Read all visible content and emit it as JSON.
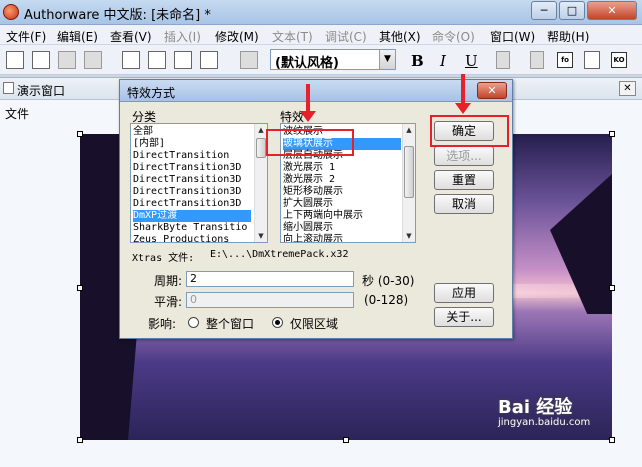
{
  "app": {
    "title": "Authorware 中文版: [未命名] *"
  },
  "window_controls": {
    "minimize": "─",
    "maximize": "□",
    "close": "✕"
  },
  "menu": [
    {
      "label": "文件(F)",
      "enabled": true
    },
    {
      "label": "编辑(E)",
      "enabled": true
    },
    {
      "label": "查看(V)",
      "enabled": true
    },
    {
      "label": "插入(I)",
      "enabled": false
    },
    {
      "label": "修改(M)",
      "enabled": true
    },
    {
      "label": "文本(T)",
      "enabled": false
    },
    {
      "label": "调试(C)",
      "enabled": false
    },
    {
      "label": "其他(X)",
      "enabled": true
    },
    {
      "label": "命令(O)",
      "enabled": false
    },
    {
      "label": "窗口(W)",
      "enabled": true
    },
    {
      "label": "帮助(H)",
      "enabled": true
    }
  ],
  "toolbar": {
    "style_value": "(默认风格)",
    "bold": "B",
    "italic": "I",
    "underline": "U",
    "icon_labels": [
      "fo",
      "KO"
    ]
  },
  "presentation": {
    "title": "演示窗口",
    "menu": "文件",
    "close": "✕"
  },
  "dialog": {
    "title": "特效方式",
    "category_label": "分类",
    "effect_label": "特效",
    "categories": [
      "全部",
      "[内部]",
      "DirectTransition",
      "DirectTransition3D",
      "DirectTransition3D",
      "DirectTransition3D",
      "DirectTransition3D",
      "DmXP过渡",
      "SharkByte Transitio",
      "Zeus Productions"
    ],
    "selected_category": 7,
    "effects": [
      "波纹展示",
      "玻璃状展示",
      "层层自动展示",
      "激光展示 1",
      "激光展示 2",
      "矩形移动展示",
      "扩大圆展示",
      "上下两端向中展示",
      "缩小圆展示",
      "向上滚动展示"
    ],
    "selected_effect": 1,
    "xtras_label": "Xtras 文件:",
    "xtras_value": "E:\\...\\DmXtremePack.x32",
    "duration_label": "周期:",
    "duration_value": "2",
    "duration_unit": "秒 (0-30)",
    "smooth_label": "平滑:",
    "smooth_value": "0",
    "smooth_range": "(0-128)",
    "affect_label": "影响:",
    "affect_options": [
      "整个窗口",
      "仅限区域"
    ],
    "affect_selected": 1,
    "buttons": {
      "ok": "确定",
      "options": "选项...",
      "reset": "重置",
      "cancel": "取消",
      "apply": "应用",
      "about": "关于..."
    }
  },
  "annotations": {
    "color": "#e8202a"
  },
  "watermark": {
    "brand": "Bai 经验",
    "url": "jingyan.baidu.com"
  }
}
